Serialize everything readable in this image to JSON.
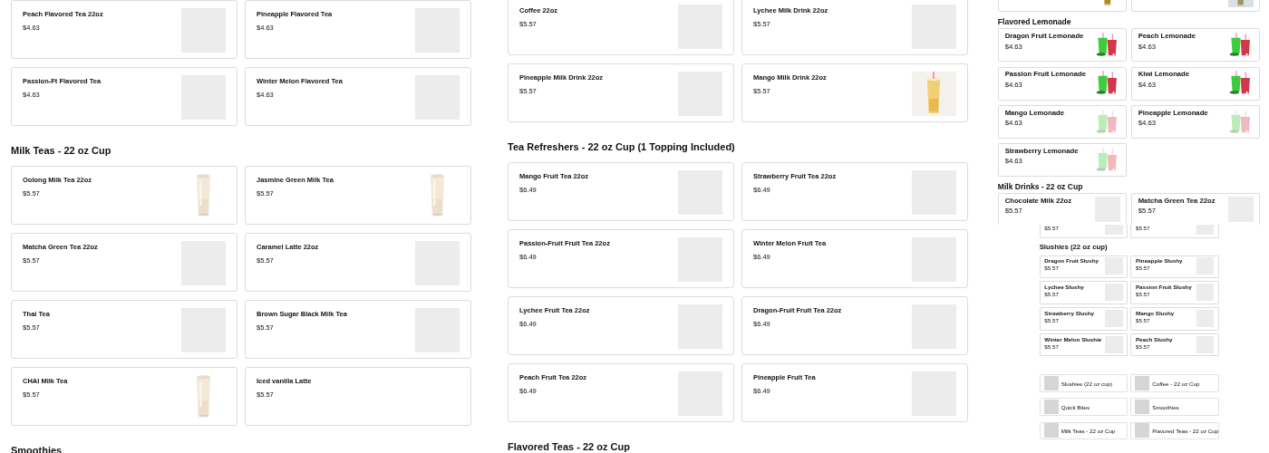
{
  "panels": [
    {
      "blocks": [
        {
          "kind": "cards",
          "items": [
            {
              "title": "Peach Flavored Tea 22oz",
              "price": "$4.63",
              "kind": "blank"
            },
            {
              "title": "Pineapple Flavored Tea",
              "price": "$4.63",
              "kind": "blank"
            },
            {
              "title": "Passion-Ft Flavored Tea",
              "price": "$4.63",
              "kind": "blank"
            },
            {
              "title": "Winter Melon Flavored Tea",
              "price": "$4.63",
              "kind": "blank"
            }
          ]
        },
        {
          "kind": "heading",
          "text": "Milk Teas - 22 oz Cup"
        },
        {
          "kind": "cards",
          "items": [
            {
              "title": "Oolong Milk Tea 22oz",
              "price": "$5.57",
              "kind": "picture"
            },
            {
              "title": "Jasmine Green Milk Tea",
              "price": "$5.57",
              "kind": "picture"
            },
            {
              "title": "Matcha Green Tea 22oz",
              "price": "$5.57",
              "kind": "blank"
            },
            {
              "title": "Caramel Latte 22oz",
              "price": "$5.57",
              "kind": "blank"
            },
            {
              "title": "Thai Tea",
              "price": "$5.57",
              "kind": "blank"
            },
            {
              "title": "Brown Sugar Black Milk Tea",
              "price": "$5.57",
              "kind": "blank"
            },
            {
              "title": "CHAI Milk Tea",
              "price": "$5.57",
              "kind": "picture"
            },
            {
              "title": "Iced vanilla Latte",
              "price": "$5.57"
            }
          ]
        },
        {
          "kind": "heading",
          "text": "Smoothies"
        }
      ]
    },
    {
      "blocks": [
        {
          "kind": "cards",
          "items": [
            {
              "title": "Coffee 22oz",
              "price": "$5.57",
              "kind": "blank"
            },
            {
              "title": "Lychee Milk Drink 22oz",
              "price": "$5.57",
              "kind": "blank"
            },
            {
              "title": "Pineapple Milk Drink 22oz",
              "price": "$5.57",
              "kind": "blank"
            },
            {
              "title": "Mango Milk Drink 22oz",
              "price": "$5.57",
              "kind": "picture"
            }
          ]
        },
        {
          "kind": "heading",
          "text": "Tea Refreshers - 22 oz Cup (1 Topping Included)"
        },
        {
          "kind": "cards",
          "items": [
            {
              "title": "Mango Fruit Tea 22oz",
              "price": "$6.49",
              "kind": "blank"
            },
            {
              "title": "Strawberry Fruit Tea 22oz",
              "price": "$6.49",
              "kind": "blank"
            },
            {
              "title": "Passion-Fruit Fruit Tea 22oz",
              "price": "$6.49",
              "kind": "blank"
            },
            {
              "title": "Winter Melon Fruit Tea",
              "price": "$6.49",
              "kind": "blank"
            },
            {
              "title": "Lychee Fruit Tea 22oz",
              "price": "$6.49",
              "kind": "blank"
            },
            {
              "title": "Dragon-Fruit Fruit Tea 22oz",
              "price": "$6.49",
              "kind": "blank"
            },
            {
              "title": "Peach Fruit Tea 22oz",
              "price": "$6.49",
              "kind": "blank"
            },
            {
              "title": "Pineapple Fruit Tea",
              "price": "$6.49",
              "kind": "blank"
            }
          ]
        },
        {
          "kind": "heading",
          "text": "Flavored Teas - 22 oz Cup"
        }
      ]
    },
    {
      "blocks": [
        {
          "kind": "cards"
        },
        {
          "kind": "heading",
          "text": "Flavored Lemonade"
        },
        {
          "kind": "cards",
          "items": [
            {
              "title": "Dragon Fruit Lemonade",
              "price": "$4.63",
              "kind": "picture"
            },
            {
              "title": "Peach Lemonade",
              "price": "$4.63",
              "kind": "picture"
            },
            {
              "title": "Passion Fruit Lemonade",
              "price": "$4.63",
              "kind": "picture"
            },
            {
              "title": "Kiwi Lemonade",
              "price": "$4.63",
              "kind": "picture"
            },
            {
              "title": "Mango Lemonade",
              "price": "$4.63",
              "kind": "picture"
            },
            {
              "title": "Pineapple Lemonade",
              "price": "$4.63",
              "kind": "picture"
            },
            {
              "title": "Strawberry Lemonade",
              "price": "$4.63",
              "kind": "picture"
            }
          ]
        },
        {
          "kind": "heading",
          "text": "Milk Drinks - 22 oz Cup"
        },
        {
          "kind": "cards",
          "items": [
            {
              "title": "Chocolate Milk 22oz",
              "price": "$5.57",
              "kind": "blank"
            },
            {
              "title": "Matcha Green Tea 22oz",
              "price": "$5.57",
              "kind": "blank"
            }
          ]
        }
      ]
    },
    {
      "blocks": [
        {
          "kind": "cards",
          "items": [
            {
              "price": "$5.57",
              "kind": "blank"
            },
            {
              "price": "$5.57",
              "kind": "blank"
            }
          ]
        },
        {
          "kind": "heading",
          "text": "Slushies (22 oz cup)"
        },
        {
          "kind": "cards",
          "items": [
            {
              "title": "Dragon Fruit Slushy",
              "price": "$5.57",
              "kind": "blank"
            },
            {
              "title": "Pineapple Slushy",
              "price": "$5.57",
              "kind": "blank"
            },
            {
              "title": "Lychee Slushy",
              "price": "$5.57",
              "kind": "blank"
            },
            {
              "title": "Passion Fruit Slushy",
              "price": "$5.57",
              "kind": "blank"
            },
            {
              "title": "Strawberry Slushy",
              "price": "$5.57",
              "kind": "blank"
            },
            {
              "title": "Mango Slushy",
              "price": "$5.57",
              "kind": "blank"
            },
            {
              "title": "Winter Melon Slushie",
              "price": "$5.57",
              "kind": "blank"
            },
            {
              "title": "Peach Slushy",
              "price": "$5.57",
              "kind": "blank"
            }
          ]
        },
        {
          "kind": "categories",
          "items": [
            {
              "label": "Slushies (22 oz cup)"
            },
            {
              "label": "Coffee - 22 oz Cup"
            },
            {
              "label": "Quick Bites"
            },
            {
              "label": "Smoothies"
            },
            {
              "label": "Milk Teas - 22 oz Cup"
            },
            {
              "label": "Flavored Teas - 22 oz Cup"
            }
          ]
        }
      ]
    }
  ]
}
